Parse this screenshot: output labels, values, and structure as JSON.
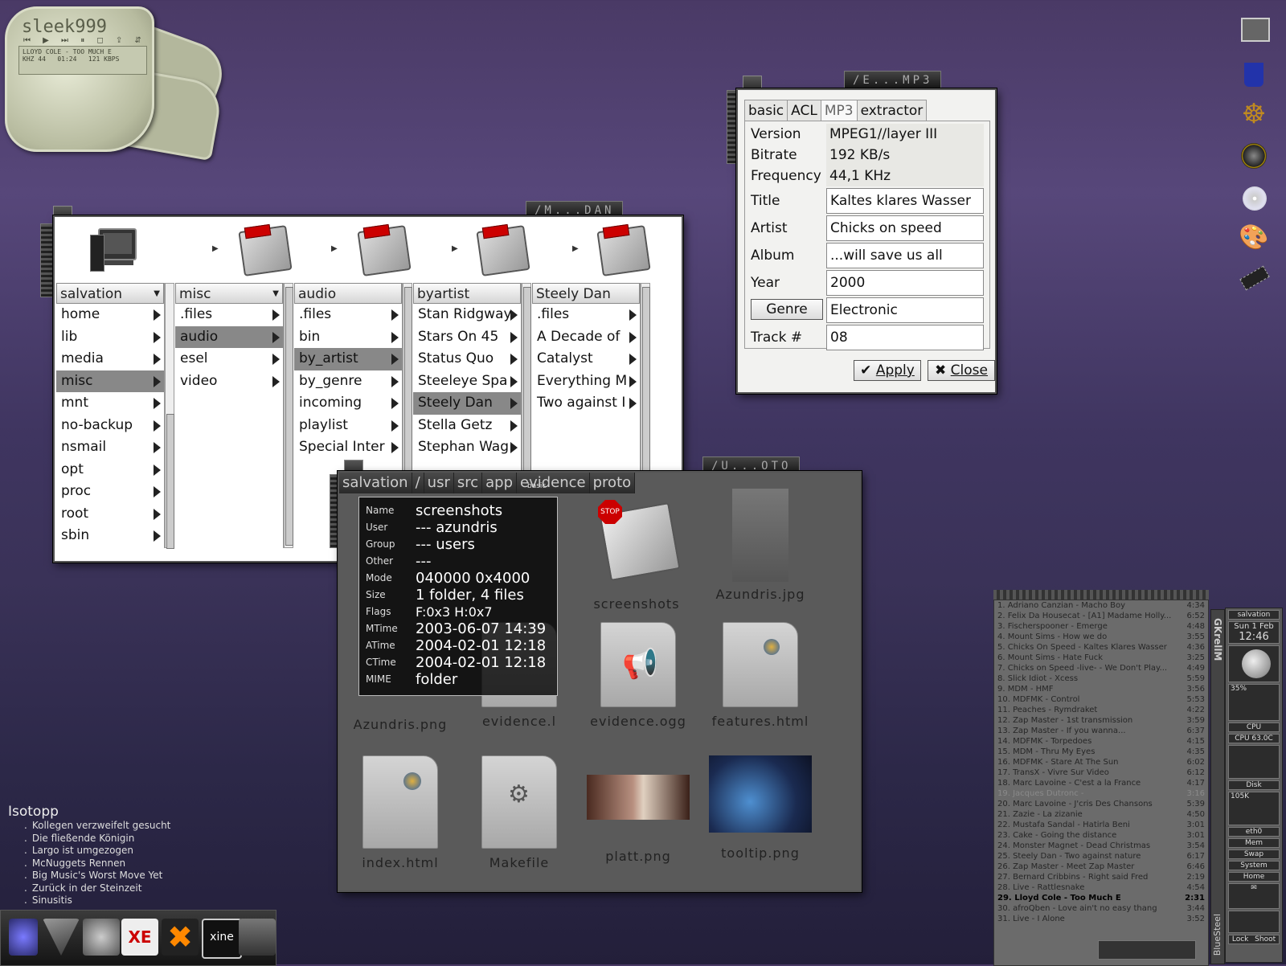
{
  "winamp": {
    "logo": "sleek999",
    "controls": "⏮ ▶ ⏭ ⏸ ◻ ⇪ ⇵ ⇴",
    "track": "LLOYD COLE - TOO MUCH E",
    "khz": "KHZ 44",
    "time": "01:24",
    "kbps": "121 KBPS"
  },
  "browser": {
    "title": "/M...DAN",
    "columns": [
      {
        "head": "salvation",
        "items": [
          "home",
          "lib",
          "media",
          "misc",
          "mnt",
          "no-backup",
          "nsmail",
          "opt",
          "proc",
          "root",
          "sbin"
        ],
        "selected": "misc"
      },
      {
        "head": "misc",
        "items": [
          ".files",
          "audio",
          "esel",
          "video"
        ],
        "selected": "audio"
      },
      {
        "head": "audio",
        "items": [
          ".files",
          "bin",
          "by_artist",
          "by_genre",
          "incoming",
          "playlist",
          "Special Inter"
        ],
        "selected": "by_artist"
      },
      {
        "head": "byartist",
        "items": [
          "Stan Ridgway",
          "Stars On 45",
          "Status Quo",
          "Steeleye Spa",
          "Steely Dan",
          "Stella Getz",
          "Stephan Wag"
        ],
        "selected": "Steely Dan"
      },
      {
        "head": "Steely Dan",
        "items": [
          ".files",
          "A Decade of",
          "Catalyst",
          "Everything M",
          "Two against I"
        ],
        "selected": ""
      }
    ]
  },
  "mp3": {
    "title": "/E...MP3",
    "tabs": [
      "basic",
      "ACL",
      "MP3",
      "extractor"
    ],
    "active_tab": "MP3",
    "version_label": "Version",
    "version": "MPEG1//layer III",
    "bitrate_label": "Bitrate",
    "bitrate": " 192 KB/s",
    "frequency_label": "Frequency",
    "frequency": "44,1 KHz",
    "title_label": "Title",
    "title_value": "Kaltes klares Wasser",
    "artist_label": "Artist",
    "artist": "Chicks on speed",
    "album_label": "Album",
    "album": "...will save us all",
    "year_label": "Year",
    "year": "2000",
    "genre_label": "Genre",
    "genre": "Electronic",
    "track_label": "Track #",
    "track": "08",
    "apply": "Apply",
    "close": "Close"
  },
  "iconview": {
    "title": "/U...OTO",
    "crumbs": [
      "salvation",
      "/",
      "usr",
      "src",
      "app",
      "evidence",
      "proto"
    ],
    "files": [
      "screenshots",
      "Azundris.jpg",
      "Azundris.png",
      "evidence.l",
      "evidence.ogg",
      "features.html",
      "index.html",
      "Makefile",
      "platt.png",
      "tooltip.png"
    ],
    "stop_sign": "STOP",
    "tooltip_tag": "basic",
    "tooltip": {
      "name_k": "Name",
      "name": "screenshots",
      "user_k": "User",
      "user": "--- azundris",
      "group_k": "Group",
      "group": "--- users",
      "other_k": "Other",
      "other": "---",
      "mode_k": "Mode",
      "mode": "040000 0x4000",
      "size_k": "Size",
      "size": "1 folder, 4 files",
      "flags_k": "Flags",
      "flags": "F:0x3 H:0x7",
      "mtime_k": "MTime",
      "mtime": "2003-06-07 14:39",
      "atime_k": "ATime",
      "atime": "2004-02-01 12:18",
      "ctime_k": "CTime",
      "ctime": "2004-02-01 12:18",
      "mime_k": "MIME",
      "mime": "folder"
    }
  },
  "playlist": [
    {
      "t": "1. Adriano Canzian - Macho Boy",
      "d": "4:34"
    },
    {
      "t": "2. Felix Da Housecat - [A1] Madame Holly...",
      "d": "6:52"
    },
    {
      "t": "3. Fischerspooner - Emerge",
      "d": "4:48"
    },
    {
      "t": "4. Mount Sims - How we do",
      "d": "3:55"
    },
    {
      "t": "5. Chicks On Speed - Kaltes Klares Wasser",
      "d": "4:36"
    },
    {
      "t": "6. Mount Sims - Hate Fuck",
      "d": "3:25"
    },
    {
      "t": "7. Chicks on Speed -live- - We Don't Play...",
      "d": "4:49"
    },
    {
      "t": "8. Slick Idiot - Xcess",
      "d": "5:59"
    },
    {
      "t": "9. MDM - HMF",
      "d": "3:56"
    },
    {
      "t": "10. MDFMK - Control",
      "d": "5:53"
    },
    {
      "t": "11. Peaches - Rymdraket",
      "d": "4:22"
    },
    {
      "t": "12. Zap Master - 1st transmission",
      "d": "3:59"
    },
    {
      "t": "13. Zap Master - If you wanna...",
      "d": "6:37"
    },
    {
      "t": "14. MDFMK - Torpedoes",
      "d": "4:15"
    },
    {
      "t": "15. MDM - Thru My Eyes",
      "d": "4:35"
    },
    {
      "t": "16. MDFMK - Stare At The Sun",
      "d": "6:02"
    },
    {
      "t": "17. TransX - Vivre Sur Video",
      "d": "6:12"
    },
    {
      "t": "18. Marc Lavoine - C'est a la France",
      "d": "4:17"
    },
    {
      "t": "19. Jacques Dutronc -",
      "d": "3:16"
    },
    {
      "t": "20. Marc Lavoine - J'cris Des Chansons",
      "d": "5:39"
    },
    {
      "t": "21. Zazie - La zizanie",
      "d": "4:50"
    },
    {
      "t": "22. Mustafa Sandal - Hatirla Beni",
      "d": "3:01"
    },
    {
      "t": "23. Cake - Going the distance",
      "d": "3:01"
    },
    {
      "t": "24. Monster Magnet - Dead Christmas",
      "d": "3:54"
    },
    {
      "t": "25. Steely Dan - Two against nature",
      "d": "6:17"
    },
    {
      "t": "26. Zap Master - Meet Zap Master",
      "d": "6:46"
    },
    {
      "t": "27. Bernard Cribbins - Right said Fred",
      "d": "2:19"
    },
    {
      "t": "28. Live - Rattlesnake",
      "d": "4:54"
    },
    {
      "t": "29. Lloyd Cole - Too Much E",
      "d": "2:31"
    },
    {
      "t": "30. afroQben - Love ain't no easy thang",
      "d": "3:44"
    },
    {
      "t": "31. Live - I Alone",
      "d": "3:52"
    }
  ],
  "playlist_current": 28,
  "playlist_dimmed": 18,
  "gkrellm": {
    "brand": "GKrellM",
    "host": "salvation",
    "date": "Sun 1 Feb",
    "time": "12:46",
    "cpu_pct": "35%",
    "cpu_label": "CPU",
    "cpu_temp": "CPU 63.0C",
    "disk": "Disk",
    "disk_rate": "105K",
    "eth": "eth0",
    "mem": "Mem",
    "swap": "Swap",
    "system": "System",
    "home": "Home",
    "lock": "Lock",
    "shoot": "Shoot",
    "theme": "BlueSteel"
  },
  "news": {
    "head": "Isotopp",
    "items": [
      "Kollegen verzweifelt gesucht",
      "Die fließende Königin",
      "Largo ist umgezogen",
      "McNuggets Rennen",
      "Big Music's Worst Move Yet",
      "Zurück in der Steinzeit",
      "Sinusitis"
    ]
  },
  "taskbar": {
    "xine_label": "xine"
  }
}
